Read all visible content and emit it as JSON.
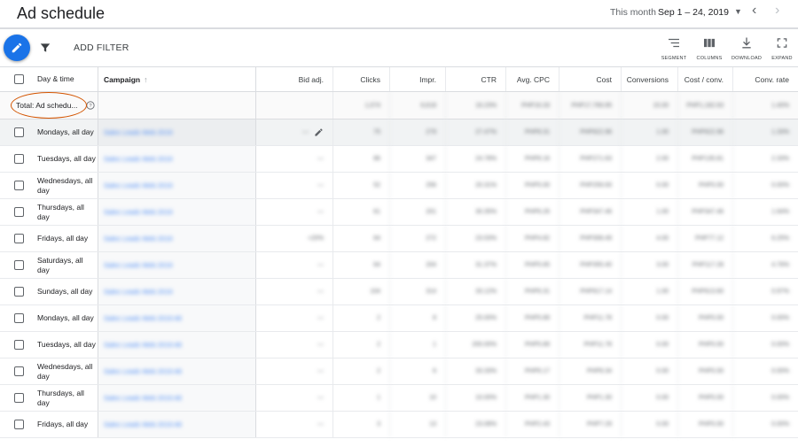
{
  "header": {
    "title": "Ad schedule",
    "date_range_label": "This month",
    "date_range_value": "Sep 1 – 24, 2019"
  },
  "toolbar": {
    "add_filter": "ADD FILTER",
    "tools": [
      {
        "label": "SEGMENT",
        "icon": "segment-icon"
      },
      {
        "label": "COLUMNS",
        "icon": "columns-icon"
      },
      {
        "label": "DOWNLOAD",
        "icon": "download-icon"
      },
      {
        "label": "EXPAND",
        "icon": "expand-icon"
      }
    ]
  },
  "colors": {
    "accent": "#1a73e8",
    "annotation": "#d35400",
    "link": "#4285f4"
  },
  "table": {
    "headers": {
      "day_time": "Day & time",
      "campaign": "Campaign",
      "bid_adj": "Bid adj.",
      "clicks": "Clicks",
      "impr": "Impr.",
      "ctr": "CTR",
      "avg_cpc": "Avg. CPC",
      "cost": "Cost",
      "conversions": "Conversions",
      "cost_conv": "Cost / conv.",
      "conv_rate": "Conv. rate"
    },
    "total": {
      "label": "Total: Ad schedu...",
      "clicks": "1,074",
      "impr": "6,618",
      "ctr": "16.23%",
      "avg_cpc": "PHP16.33",
      "cost": "PHP17,769.95",
      "conversions": "15.00",
      "cost_conv": "PHP1,182.63",
      "conv_rate": "1.40%"
    },
    "rows": [
      {
        "day": "Mondays, all day",
        "campaign": "Sales Leads Web 2019",
        "bid_adj": "—",
        "clicks": "75",
        "impr": "279",
        "ctr": "27.47%",
        "avg_cpc": "PHP8.31",
        "cost": "PHP622.96",
        "conversions": "1.00",
        "cost_conv": "PHP622.96",
        "conv_rate": "1.33%"
      },
      {
        "day": "Tuesdays, all day",
        "campaign": "Sales Leads Web 2019",
        "bid_adj": "—",
        "clicks": "86",
        "impr": "347",
        "ctr": "24.78%",
        "avg_cpc": "PHP8.16",
        "cost": "PHP271.63",
        "conversions": "2.00",
        "cost_conv": "PHP135.81",
        "conv_rate": "2.33%"
      },
      {
        "day": "Wednesdays, all day",
        "campaign": "Sales Leads Web 2019",
        "bid_adj": "—",
        "clicks": "52",
        "impr": "256",
        "ctr": "20.31%",
        "avg_cpc": "PHP5.00",
        "cost": "PHP259.93",
        "conversions": "0.00",
        "cost_conv": "PHP0.00",
        "conv_rate": "0.00%"
      },
      {
        "day": "Thursdays, all day",
        "campaign": "Sales Leads Web 2019",
        "bid_adj": "—",
        "clicks": "61",
        "impr": "201",
        "ctr": "30.35%",
        "avg_cpc": "PHP6.26",
        "cost": "PHP347.46",
        "conversions": "1.00",
        "cost_conv": "PHP347.46",
        "conv_rate": "1.64%"
      },
      {
        "day": "Fridays, all day",
        "campaign": "Sales Leads Web 2019",
        "bid_adj": "+20%",
        "clicks": "64",
        "impr": "272",
        "ctr": "23.53%",
        "avg_cpc": "PHP4.82",
        "cost": "PHP308.49",
        "conversions": "4.00",
        "cost_conv": "PHP77.12",
        "conv_rate": "6.25%"
      },
      {
        "day": "Saturdays, all day",
        "campaign": "Sales Leads Web 2019",
        "bid_adj": "—",
        "clicks": "64",
        "impr": "204",
        "ctr": "31.37%",
        "avg_cpc": "PHP5.65",
        "cost": "PHP355.40",
        "conversions": "3.00",
        "cost_conv": "PHP117.28",
        "conv_rate": "4.76%"
      },
      {
        "day": "Sundays, all day",
        "campaign": "Sales Leads Web 2019",
        "bid_adj": "—",
        "clicks": "104",
        "impr": "314",
        "ctr": "33.12%",
        "avg_cpc": "PHP6.31",
        "cost": "PHP617.14",
        "conversions": "1.00",
        "cost_conv": "PHP613.60",
        "conv_rate": "0.97%"
      },
      {
        "day": "Mondays, all day",
        "campaign": "Sales Leads Web 2019 Alt",
        "bid_adj": "—",
        "clicks": "2",
        "impr": "8",
        "ctr": "25.00%",
        "avg_cpc": "PHP5.89",
        "cost": "PHP11.78",
        "conversions": "0.00",
        "cost_conv": "PHP0.00",
        "conv_rate": "0.00%"
      },
      {
        "day": "Tuesdays, all day",
        "campaign": "Sales Leads Web 2019 Alt",
        "bid_adj": "—",
        "clicks": "2",
        "impr": "1",
        "ctr": "200.00%",
        "avg_cpc": "PHP5.89",
        "cost": "PHP11.78",
        "conversions": "0.00",
        "cost_conv": "PHP0.00",
        "conv_rate": "0.00%"
      },
      {
        "day": "Wednesdays, all day",
        "campaign": "Sales Leads Web 2019 Alt",
        "bid_adj": "—",
        "clicks": "2",
        "impr": "6",
        "ctr": "33.33%",
        "avg_cpc": "PHP6.17",
        "cost": "PHP8.34",
        "conversions": "0.00",
        "cost_conv": "PHP0.00",
        "conv_rate": "0.00%"
      },
      {
        "day": "Thursdays, all day",
        "campaign": "Sales Leads Web 2019 Alt",
        "bid_adj": "—",
        "clicks": "1",
        "impr": "10",
        "ctr": "10.00%",
        "avg_cpc": "PHP1.30",
        "cost": "PHP1.30",
        "conversions": "0.00",
        "cost_conv": "PHP0.00",
        "conv_rate": "0.00%"
      },
      {
        "day": "Fridays, all day",
        "campaign": "Sales Leads Web 2019 Alt",
        "bid_adj": "—",
        "clicks": "3",
        "impr": "13",
        "ctr": "23.08%",
        "avg_cpc": "PHP2.43",
        "cost": "PHP7.29",
        "conversions": "0.00",
        "cost_conv": "PHP0.00",
        "conv_rate": "0.00%"
      }
    ]
  }
}
